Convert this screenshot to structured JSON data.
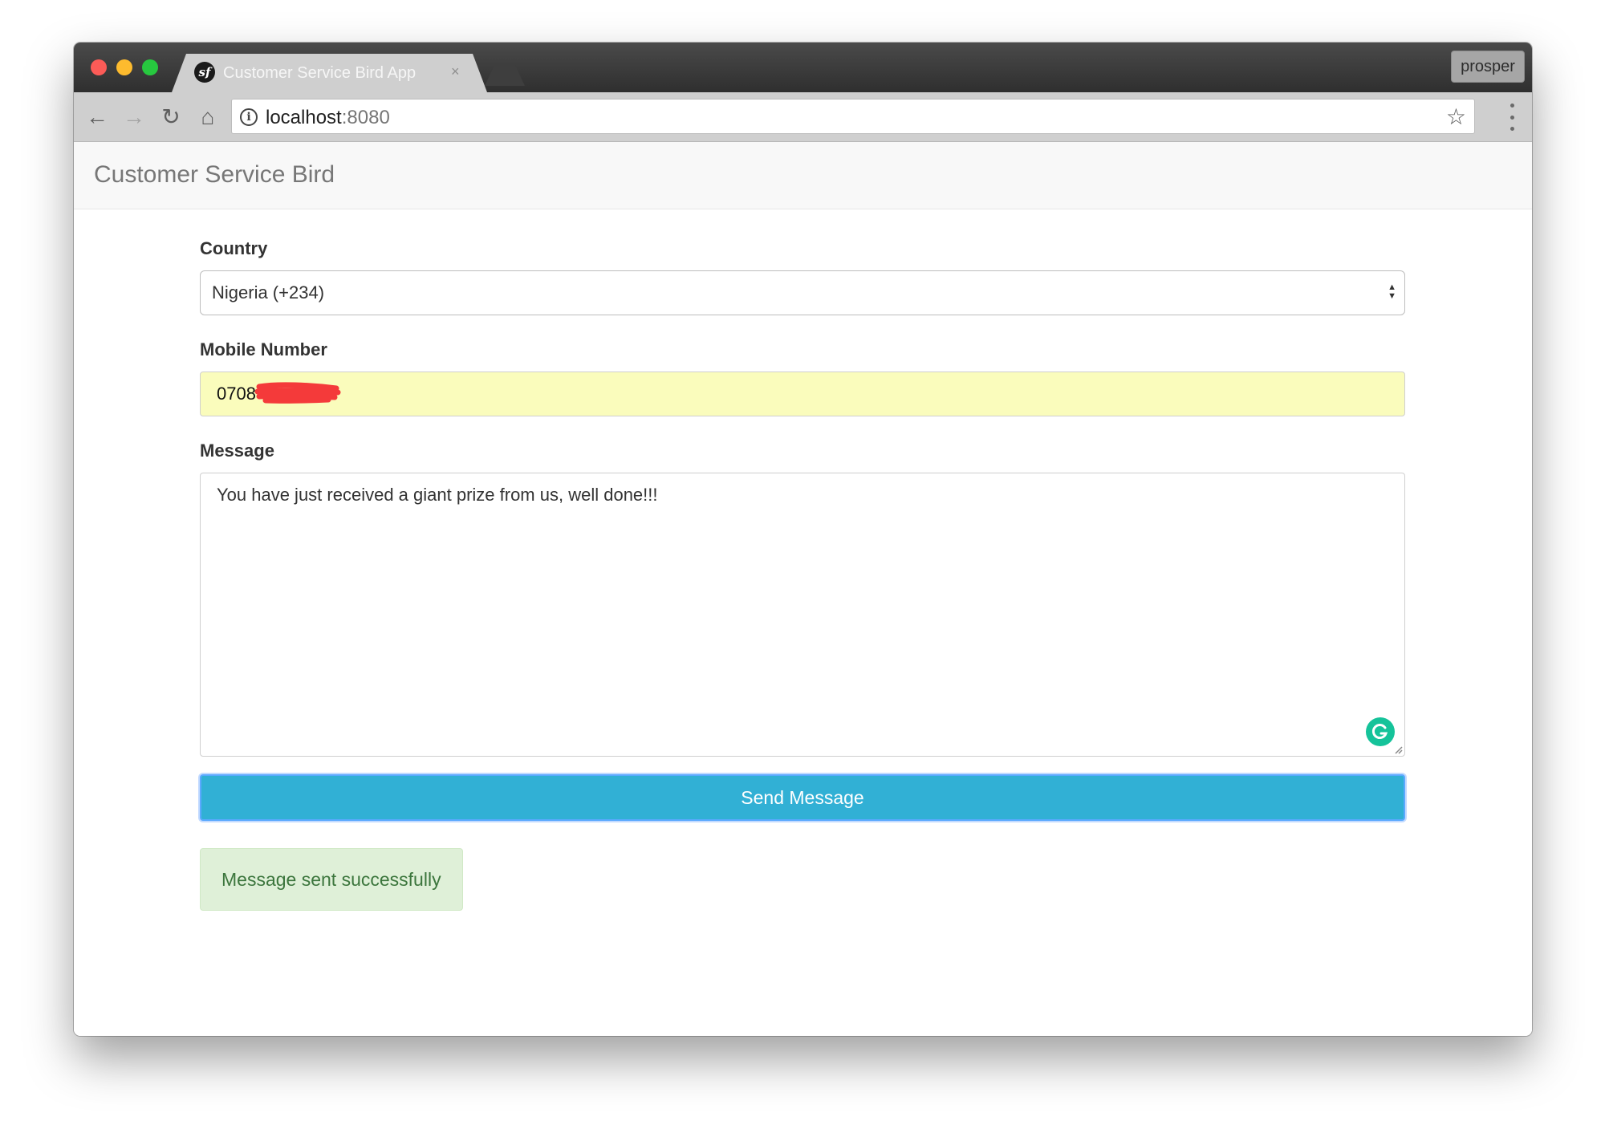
{
  "browser": {
    "tab_title": "Customer Service Bird App",
    "tab_close": "×",
    "tab_favicon": "sf",
    "profile_name": "prosper",
    "url_host": "localhost",
    "url_port": ":8080",
    "icons": {
      "back": "←",
      "forward": "→",
      "reload": "↻",
      "home": "⌂",
      "info": "i",
      "star": "☆"
    }
  },
  "navbar": {
    "brand": "Customer Service Bird"
  },
  "form": {
    "country_label": "Country",
    "country_value": "Nigeria (+234)",
    "mobile_label": "Mobile Number",
    "mobile_value": "0708",
    "message_label": "Message",
    "message_value": "You have just received a giant prize from us, well done!!!",
    "send_button": "Send Message"
  },
  "alert": {
    "text": "Message sent successfully"
  },
  "colors": {
    "button": "#31b0d5",
    "alert_bg": "#dff0d8",
    "alert_text": "#3c763d",
    "autofill_bg": "#fafcbc",
    "redaction": "#f43a3a",
    "grammarly": "#15c39a"
  }
}
